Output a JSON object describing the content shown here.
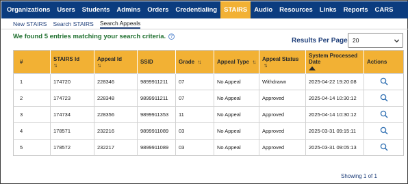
{
  "nav": {
    "items": [
      "Organizations",
      "Users",
      "Students",
      "Admins",
      "Orders",
      "Credentialing",
      "STAIRS",
      "Audio",
      "Resources",
      "Links",
      "Reports",
      "CARS"
    ],
    "active": "STAIRS"
  },
  "subnav": {
    "items": [
      "New STAIRS",
      "Search STAIRS",
      "Search Appeals"
    ],
    "active": "Search Appeals"
  },
  "message": "We found 5 entries matching your search criteria.",
  "help_icon_glyph": "?",
  "results_per_page": {
    "label": "Results Per Page",
    "value": "20"
  },
  "table": {
    "headers": {
      "num": "#",
      "stairs_id": "STAIRS Id",
      "appeal_id": "Appeal Id",
      "ssid": "SSID",
      "grade": "Grade",
      "appeal_type": "Appeal Type",
      "appeal_status": "Appeal Status",
      "processed": "System Processed Date",
      "actions": "Actions"
    },
    "sort_glyph": "↑↓",
    "rows": [
      {
        "num": "1",
        "stairs_id": "174720",
        "appeal_id": "228346",
        "ssid": "9899911211",
        "grade": "07",
        "appeal_type": "No Appeal",
        "appeal_status": "Withdrawn",
        "processed": "2025-04-22 19:20:08"
      },
      {
        "num": "2",
        "stairs_id": "174723",
        "appeal_id": "228348",
        "ssid": "9899911211",
        "grade": "07",
        "appeal_type": "No Appeal",
        "appeal_status": "Approved",
        "processed": "2025-04-14 10:30:12"
      },
      {
        "num": "3",
        "stairs_id": "174734",
        "appeal_id": "228356",
        "ssid": "9899911353",
        "grade": "11",
        "appeal_type": "No Appeal",
        "appeal_status": "Approved",
        "processed": "2025-04-14 10:30:12"
      },
      {
        "num": "4",
        "stairs_id": "178571",
        "appeal_id": "232216",
        "ssid": "9899911089",
        "grade": "03",
        "appeal_type": "No Appeal",
        "appeal_status": "Approved",
        "processed": "2025-03-31 09:15:11"
      },
      {
        "num": "5",
        "stairs_id": "178572",
        "appeal_id": "232217",
        "ssid": "9899911089",
        "grade": "03",
        "appeal_type": "No Appeal",
        "appeal_status": "Approved",
        "processed": "2025-03-31 09:05:13"
      }
    ],
    "action_icon": "search-icon"
  },
  "footer": {
    "showing": "Showing 1 of 1"
  },
  "colors": {
    "nav_bg": "#0b3c7f",
    "accent": "#f2b134",
    "success_text": "#1e6f2e",
    "link": "#1f3f7a"
  }
}
